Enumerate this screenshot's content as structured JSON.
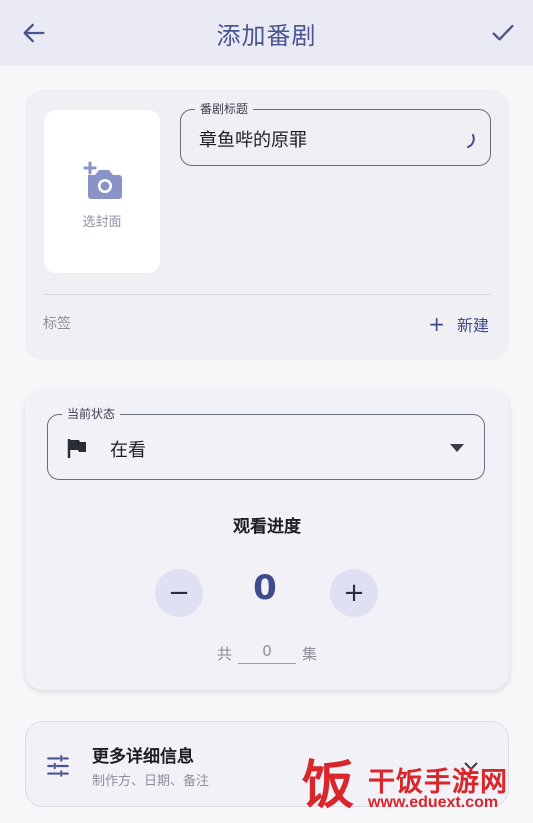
{
  "appbar": {
    "title": "添加番剧",
    "back_icon": "arrow-back-icon",
    "confirm_icon": "check-icon",
    "background": "#e9eaf4",
    "accent": "#4a5590"
  },
  "cover": {
    "label": "选封面",
    "icon": "add-photo-icon"
  },
  "title_field": {
    "legend": "番剧标题",
    "value": "章鱼哔的原罪"
  },
  "tags": {
    "label": "标签",
    "new_icon": "plus-icon",
    "new_label": "新建"
  },
  "status_field": {
    "legend": "当前状态",
    "icon": "flag-icon",
    "value": "在看",
    "dropdown_icon": "dropdown-arrow-icon"
  },
  "progress": {
    "title": "观看进度",
    "minus_label": "−",
    "plus_label": "+",
    "current": "0",
    "total_prefix": "共",
    "total_value": "0",
    "total_suffix": "集"
  },
  "more_details": {
    "icon": "tune-icon",
    "title": "更多详细信息",
    "subtitle": "制作方、日期、备注",
    "expand_icon": "expand-icon"
  },
  "watermark": {
    "badge": "饭",
    "name": "干饭手游网",
    "url": "www.eduext.com",
    "color": "#d9262b"
  }
}
